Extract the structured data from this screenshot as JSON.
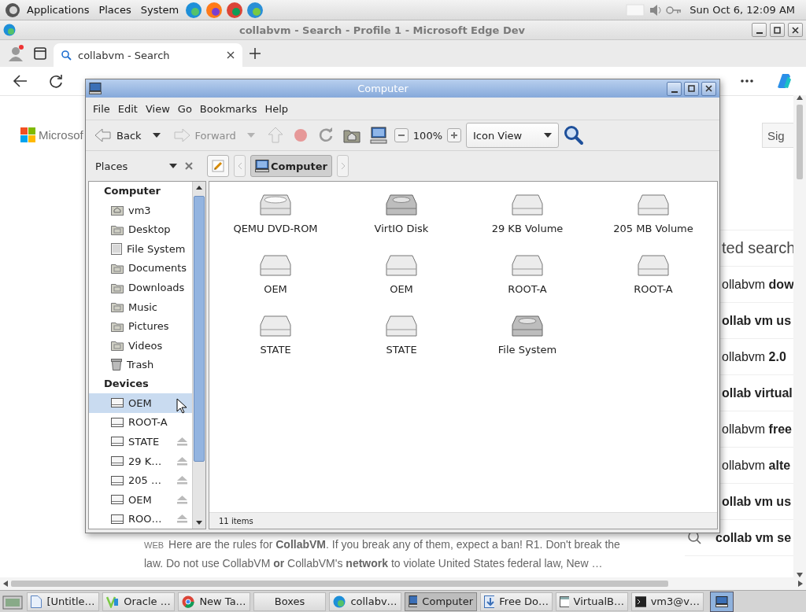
{
  "panel": {
    "menus": [
      "Applications",
      "Places",
      "System"
    ],
    "launchers": [
      {
        "kind": "edge"
      },
      {
        "kind": "firefox"
      },
      {
        "kind": "chrome"
      },
      {
        "kind": "code"
      }
    ],
    "clock": "Sun Oct 6, 12:09 AM"
  },
  "browser": {
    "title": "collabvm - Search - Profile 1 - Microsoft Edge Dev",
    "tabs": [
      {
        "label": "collabvm - Search",
        "selected": true
      }
    ],
    "logo": "Microsof",
    "sign_in": "Sig",
    "related_heading": "ted search",
    "related": [
      {
        "text": "ollabvm **dow**",
        "bold": false,
        "icon": false
      },
      {
        "text": "ollab vm us",
        "bold": true,
        "icon": false
      },
      {
        "text": "ollabvm **2.0**",
        "bold": false,
        "icon": false
      },
      {
        "text": "ollab virtual",
        "bold": true,
        "icon": false
      },
      {
        "text": "ollabvm **free**",
        "bold": false,
        "icon": false
      },
      {
        "text": "ollabvm **alte**",
        "bold": false,
        "icon": false
      },
      {
        "text": "ollab vm us",
        "bold": true,
        "icon": false
      },
      {
        "text": "collab vm se",
        "bold": true,
        "icon": true
      }
    ],
    "result": {
      "source": "WEB",
      "snippet": "Here are the rules for **CollabVM**. If you break any of them, expect a ban! R1. Don't break the law. Do not use CollabVM **or** CollabVM's **network** to violate United States federal law, New …"
    }
  },
  "file_manager": {
    "title": "Computer",
    "menus": [
      "File",
      "Edit",
      "View",
      "Go",
      "Bookmarks",
      "Help"
    ],
    "toolbar": [
      {
        "kind": "back",
        "label": "Back",
        "disabled": false,
        "menu": true
      },
      {
        "kind": "forward",
        "label": "Forward",
        "disabled": true,
        "menu": true
      },
      {
        "kind": "up",
        "disabled": true,
        "menu": false
      },
      {
        "kind": "stop",
        "disabled": true,
        "menu": false
      },
      {
        "kind": "reload",
        "disabled": false,
        "menu": false
      },
      {
        "kind": "home",
        "disabled": false,
        "menu": false
      },
      {
        "kind": "computer",
        "disabled": false,
        "menu": false
      }
    ],
    "zoom": "100%",
    "view": "Icon View",
    "places": "Places",
    "path": [
      {
        "label": "Computer",
        "selected": true
      }
    ],
    "sidebar": [
      {
        "title": "Computer",
        "items": [
          {
            "label": "vm3",
            "kind": "home",
            "selected": false,
            "eject": false
          },
          {
            "label": "Desktop",
            "kind": "folder",
            "selected": false,
            "eject": false
          },
          {
            "label": "File System",
            "kind": "filesystem",
            "selected": false,
            "eject": false
          },
          {
            "label": "Documents",
            "kind": "folder",
            "selected": false,
            "eject": false
          },
          {
            "label": "Downloads",
            "kind": "folder",
            "selected": false,
            "eject": false
          },
          {
            "label": "Music",
            "kind": "folder",
            "selected": false,
            "eject": false
          },
          {
            "label": "Pictures",
            "kind": "folder",
            "selected": false,
            "eject": false
          },
          {
            "label": "Videos",
            "kind": "folder",
            "selected": false,
            "eject": false
          },
          {
            "label": "Trash",
            "kind": "trash",
            "selected": false,
            "eject": false
          }
        ]
      },
      {
        "title": "Devices",
        "items": [
          {
            "label": "OEM",
            "kind": "drive",
            "selected": true,
            "eject": false
          },
          {
            "label": "ROOT-A",
            "kind": "drive",
            "selected": false,
            "eject": false
          },
          {
            "label": "STATE",
            "kind": "drive",
            "selected": false,
            "eject": true
          },
          {
            "label": "29 K…",
            "kind": "drive",
            "selected": false,
            "eject": true
          },
          {
            "label": "205 …",
            "kind": "drive",
            "selected": false,
            "eject": true
          },
          {
            "label": "OEM",
            "kind": "drive",
            "selected": false,
            "eject": true
          },
          {
            "label": "ROO…",
            "kind": "drive",
            "selected": false,
            "eject": true
          }
        ]
      }
    ],
    "items": [
      {
        "name": "QEMU DVD-ROM",
        "kind": "optical"
      },
      {
        "name": "VirtIO Disk",
        "kind": "harddisk"
      },
      {
        "name": "29 KB Volume",
        "kind": "volume"
      },
      {
        "name": "205 MB Volume",
        "kind": "volume"
      },
      {
        "name": "OEM",
        "kind": "volume"
      },
      {
        "name": "OEM",
        "kind": "volume"
      },
      {
        "name": "ROOT-A",
        "kind": "volume"
      },
      {
        "name": "ROOT-A",
        "kind": "volume"
      },
      {
        "name": "STATE",
        "kind": "volume"
      },
      {
        "name": "STATE",
        "kind": "volume"
      },
      {
        "name": "File System",
        "kind": "harddisk"
      }
    ],
    "status": "11 items"
  },
  "taskbar": [
    {
      "label": "[Untitle…",
      "kind": "document",
      "selected": false
    },
    {
      "label": "Oracle …",
      "kind": "code",
      "selected": false
    },
    {
      "label": "New Ta…",
      "kind": "chrome",
      "selected": false
    },
    {
      "label": "Boxes",
      "kind": "none",
      "selected": false
    },
    {
      "label": "collabv…",
      "kind": "edge",
      "selected": false
    },
    {
      "label": "Computer",
      "kind": "computer",
      "selected": true
    },
    {
      "label": "Free Do…",
      "kind": "download",
      "selected": false
    },
    {
      "label": "VirtualB…",
      "kind": "window",
      "selected": false
    },
    {
      "label": "vm3@v…",
      "kind": "terminal",
      "selected": false
    }
  ]
}
